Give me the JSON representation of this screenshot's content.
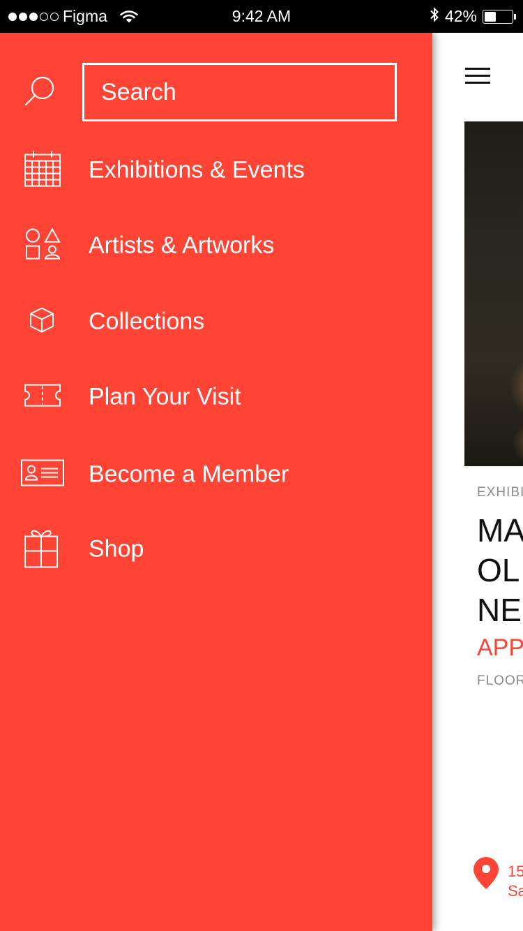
{
  "colors": {
    "accent": "#ff4436",
    "drawer_text": "#ffffff",
    "status_bar_bg": "#000000",
    "muted_text": "#8a8a8a"
  },
  "status_bar": {
    "carrier": "Figma",
    "time": "9:42 AM",
    "battery_percent": "42%",
    "battery_level": 0.42,
    "signal_bars_filled": 3,
    "signal_bars_total": 5,
    "icons": [
      "signal-dots-icon",
      "wifi-icon",
      "bluetooth-icon",
      "battery-icon"
    ]
  },
  "drawer": {
    "search": {
      "icon": "search-icon",
      "placeholder": "Search",
      "value": ""
    },
    "menu": [
      {
        "id": "exhibitions",
        "label": "Exhibitions & Events",
        "icon": "calendar-icon"
      },
      {
        "id": "artists",
        "label": "Artists & Artworks",
        "icon": "shapes-icon"
      },
      {
        "id": "collections",
        "label": "Collections",
        "icon": "cube-icon"
      },
      {
        "id": "visit",
        "label": "Plan Your Visit",
        "icon": "ticket-icon"
      },
      {
        "id": "member",
        "label": "Become a Member",
        "icon": "member-card-icon"
      },
      {
        "id": "shop",
        "label": "Shop",
        "icon": "gift-icon"
      }
    ]
  },
  "background_page": {
    "menu_icon": "hamburger-icon",
    "exhibition": {
      "category": "EXHIBI",
      "title": "MA\nOL\nNE",
      "date": "APP",
      "floor": "FLOOR"
    },
    "location": {
      "icon": "map-pin-icon",
      "address": "15\nSa"
    }
  }
}
